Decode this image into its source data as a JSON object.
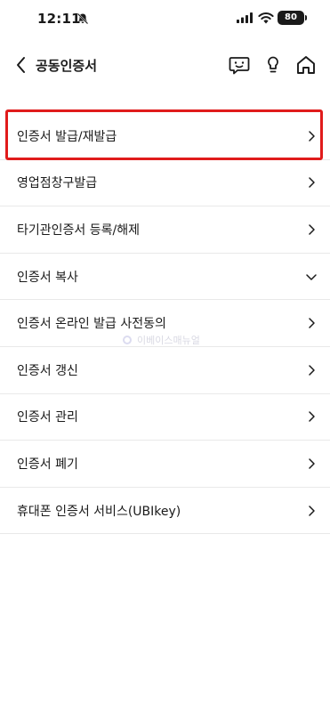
{
  "status_bar": {
    "time": "12:11",
    "battery": "80",
    "icons": [
      "bell-slash-icon",
      "cellular-signal-icon",
      "wifi-icon",
      "battery-icon"
    ]
  },
  "header": {
    "title": "공동인증서",
    "icons": [
      "back-arrow-icon",
      "chatbot-icon",
      "lightbulb-icon",
      "home-icon"
    ]
  },
  "menu": {
    "items": [
      {
        "label": "인증서 발급/재발급",
        "chevron": "chevron-right-icon",
        "highlighted": true
      },
      {
        "label": "영업점창구발급",
        "chevron": "chevron-right-icon"
      },
      {
        "label": "타기관인증서 등록/해제",
        "chevron": "chevron-right-icon"
      },
      {
        "label": "인증서 복사",
        "chevron": "chevron-down-icon"
      },
      {
        "label": "인증서 온라인 발급 사전동의",
        "chevron": "chevron-right-icon"
      },
      {
        "label": "인증서 갱신",
        "chevron": "chevron-right-icon"
      },
      {
        "label": "인증서 관리",
        "chevron": "chevron-right-icon"
      },
      {
        "label": "인증서 폐기",
        "chevron": "chevron-right-icon"
      },
      {
        "label": "휴대폰 인증서 서비스(UBIkey)",
        "chevron": "chevron-right-icon"
      }
    ]
  },
  "watermark": {
    "text": "이베이스매뉴얼"
  },
  "colors": {
    "highlight": "#e01b1b",
    "divider": "#e9e9e9",
    "text": "#1a1a1a"
  }
}
